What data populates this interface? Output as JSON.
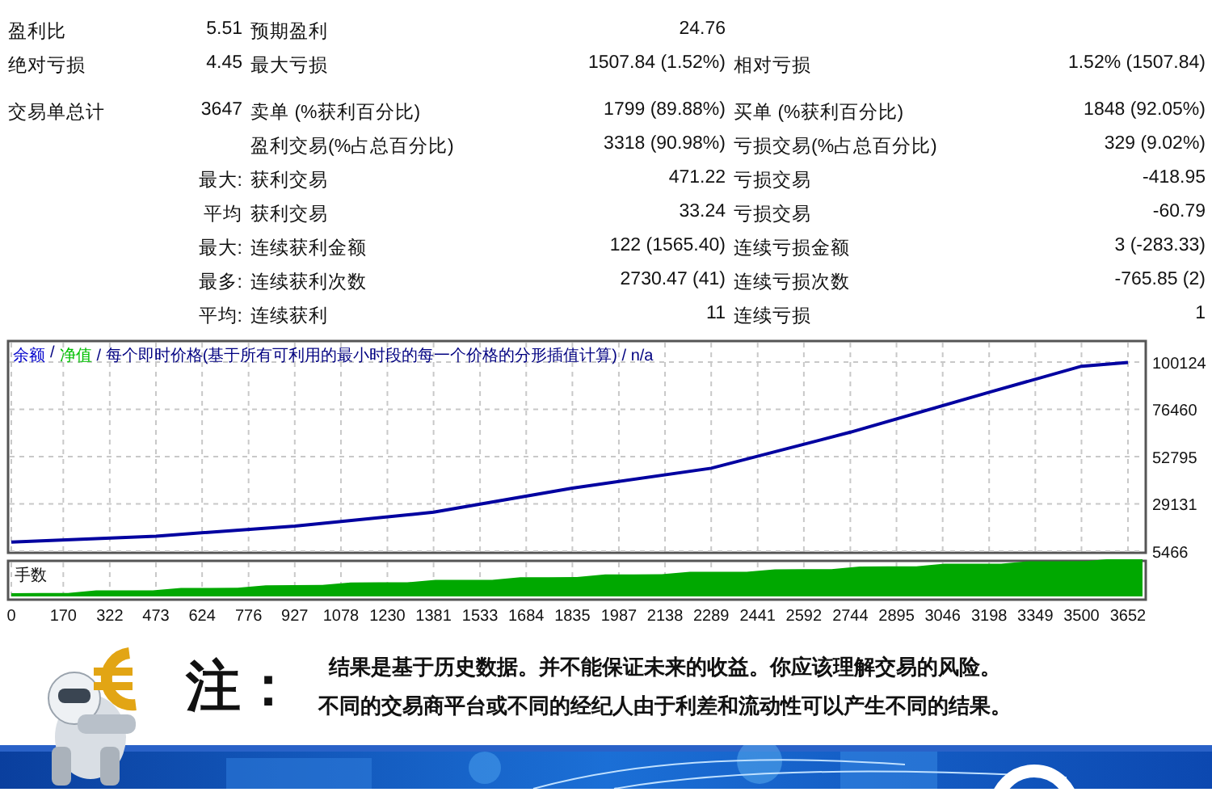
{
  "summary_rows": [
    [
      {
        "label": "盈利比",
        "value": "5.51"
      },
      {
        "label": "预期盈利",
        "value": "24.76"
      },
      null
    ],
    [
      {
        "label": "绝对亏损",
        "value": "4.45"
      },
      {
        "label": "最大亏损",
        "value": "1507.84 (1.52%)"
      },
      {
        "label": "相对亏损",
        "value": "1.52% (1507.84)"
      }
    ]
  ],
  "trade_rows": [
    [
      {
        "label": "交易单总计",
        "value": "3647"
      },
      {
        "label": "卖单 (%获利百分比)",
        "value": "1799 (89.88%)"
      },
      {
        "label": "买单 (%获利百分比)",
        "value": "1848 (92.05%)"
      }
    ],
    [
      null,
      {
        "label": "盈利交易(%占总百分比)",
        "value": "3318 (90.98%)"
      },
      {
        "label": "亏损交易(%占总百分比)",
        "value": "329 (9.02%)"
      }
    ],
    [
      {
        "value": "最大:"
      },
      {
        "label": "获利交易",
        "value": "471.22"
      },
      {
        "label": "亏损交易",
        "value": "-418.95"
      }
    ],
    [
      {
        "value": "平均"
      },
      {
        "label": "获利交易",
        "value": "33.24"
      },
      {
        "label": "亏损交易",
        "value": "-60.79"
      }
    ],
    [
      {
        "value": "最大:"
      },
      {
        "label": "连续获利金额",
        "value": "122 (1565.40)"
      },
      {
        "label": "连续亏损金额",
        "value": "3 (-283.33)"
      }
    ],
    [
      {
        "value": "最多:"
      },
      {
        "label": "连续获利次数",
        "value": "2730.47 (41)"
      },
      {
        "label": "连续亏损次数",
        "value": "-765.85 (2)"
      }
    ],
    [
      {
        "value": "平均:"
      },
      {
        "label": "连续获利",
        "value": "11"
      },
      {
        "label": "连续亏损",
        "value": "1"
      }
    ]
  ],
  "chart": {
    "legend": [
      {
        "text": "余额",
        "color": "#0000cc"
      },
      {
        "text": "/",
        "color": "#000080"
      },
      {
        "text": "净值",
        "color": "#00c000"
      },
      {
        "text": "/ 每个即时价格(基于所有可利用的最小时段的每一个价格的分形插值计算) / n/a",
        "color": "#000080"
      }
    ],
    "chart_data": {
      "type": "line",
      "x": [
        0,
        473,
        927,
        1381,
        1835,
        2289,
        2744,
        3198,
        3500,
        3652
      ],
      "series": [
        {
          "color": "#0000a0",
          "values": [
            10000,
            13000,
            18000,
            25000,
            37000,
            47000,
            65000,
            85000,
            98000,
            100000
          ]
        }
      ],
      "grid": true,
      "xlim": [
        0,
        3652
      ],
      "ylim": [
        5466,
        100124
      ],
      "xticks": [
        0,
        170,
        322,
        473,
        624,
        776,
        927,
        1078,
        1230,
        1381,
        1533,
        1684,
        1835,
        1987,
        2138,
        2289,
        2441,
        2592,
        2744,
        2895,
        3046,
        3198,
        3349,
        3500,
        3652
      ],
      "yticks": [
        5466,
        29131,
        52795,
        76460,
        100124
      ]
    },
    "volume_label": "手数"
  },
  "note": {
    "mark": "注：",
    "lines": [
      "结果是基于历史数据。并不能保证未来的收益。你应该理解交易的风险。",
      "不同的交易商平台或不同的经纪人由于利差和流动性可以产生不同的结果。"
    ]
  }
}
